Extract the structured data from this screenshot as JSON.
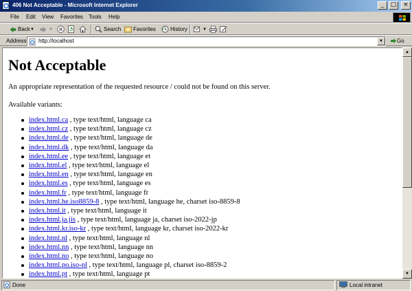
{
  "window": {
    "title": "406 Not Acceptable - Microsoft Internet Explorer",
    "controls": [
      "_",
      "□",
      "×"
    ]
  },
  "menu": [
    "File",
    "Edit",
    "View",
    "Favorites",
    "Tools",
    "Help"
  ],
  "toolbar": {
    "back": "Back",
    "search": "Search",
    "favorites": "Favorites",
    "history": "History"
  },
  "address": {
    "label": "Address",
    "url": "http://localhost",
    "go": "Go"
  },
  "page": {
    "heading": "Not Acceptable",
    "message": "An appropriate representation of the requested resource / could not be found on this server.",
    "variants_label": "Available variants:",
    "variants": [
      {
        "link": "index.html.ca",
        "desc": " , type text/html, language ca"
      },
      {
        "link": "index.html.cz",
        "desc": " , type text/html, language cz"
      },
      {
        "link": "index.html.de",
        "desc": " , type text/html, language de"
      },
      {
        "link": "index.html.dk",
        "desc": " , type text/html, language da"
      },
      {
        "link": "index.html.ee",
        "desc": " , type text/html, language et"
      },
      {
        "link": "index.html.el",
        "desc": " , type text/html, language el"
      },
      {
        "link": "index.html.en",
        "desc": " , type text/html, language en"
      },
      {
        "link": "index.html.es",
        "desc": " , type text/html, language es"
      },
      {
        "link": "index.html.fr",
        "desc": " , type text/html, language fr"
      },
      {
        "link": "index.html.he.iso8859-8",
        "desc": " , type text/html, language he, charset iso-8859-8"
      },
      {
        "link": "index.html.it",
        "desc": " , type text/html, language it"
      },
      {
        "link": "index.html.ja.jis",
        "desc": " , type text/html, language ja, charset iso-2022-jp"
      },
      {
        "link": "index.html.kr.iso-kr",
        "desc": " , type text/html, language kr, charset iso-2022-kr"
      },
      {
        "link": "index.html.nl",
        "desc": " , type text/html, language nl"
      },
      {
        "link": "index.html.nn",
        "desc": " , type text/html, language nn"
      },
      {
        "link": "index.html.no",
        "desc": " , type text/html, language no"
      },
      {
        "link": "index.html.po.iso-pl",
        "desc": " , type text/html, language pl, charset iso-8859-2"
      },
      {
        "link": "index.html.pt",
        "desc": " , type text/html, language pt"
      }
    ]
  },
  "status": {
    "left": "Done",
    "zone": "Local intranet"
  },
  "colors": {
    "link": "#0000cc",
    "titlebar": "#0a246a",
    "chrome": "#d4d0c8"
  }
}
